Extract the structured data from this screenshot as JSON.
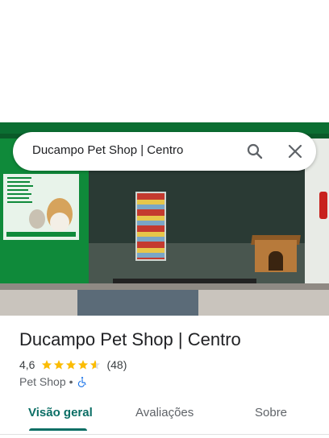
{
  "search": {
    "query": "Ducampo Pet Shop | Centro"
  },
  "place": {
    "name": "Ducampo Pet Shop | Centro",
    "rating": "4,6",
    "rating_stars": 4.6,
    "review_count": "(48)",
    "category": "Pet Shop",
    "separator": "•",
    "accessibility": "wheelchair-accessible-icon"
  },
  "tabs": [
    {
      "label": "Visão geral",
      "active": true
    },
    {
      "label": "Avaliações",
      "active": false
    },
    {
      "label": "Sobre",
      "active": false
    }
  ],
  "icons": {
    "search": "search-icon",
    "close": "close-icon",
    "star": "star-icon"
  },
  "colors": {
    "active_tab": "#0b6e65",
    "star": "#fbbc04",
    "accessibility": "#1a73e8",
    "storefront_green": "#0f8a3a"
  }
}
